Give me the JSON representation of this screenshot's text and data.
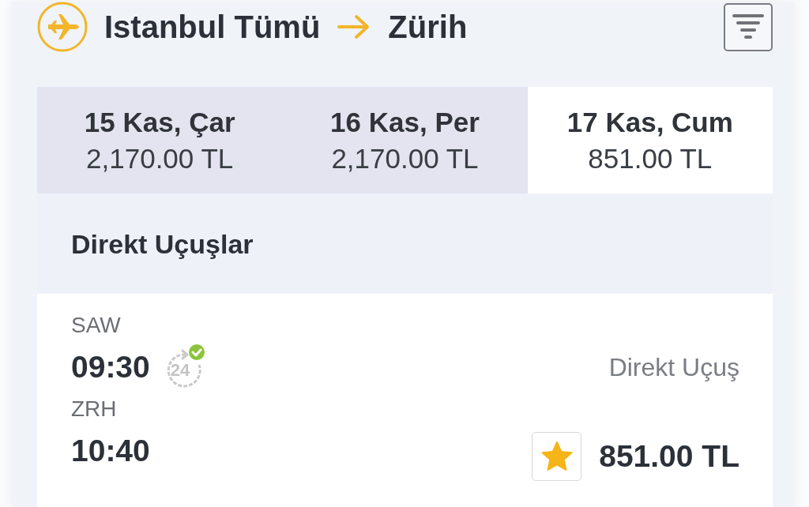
{
  "header": {
    "origin": "Istanbul Tümü",
    "destination": "Zürih"
  },
  "date_tabs": [
    {
      "date": "15 Kas, Çar",
      "price": "2,170.00 TL",
      "selected": false
    },
    {
      "date": "16 Kas, Per",
      "price": "2,170.00 TL",
      "selected": false
    },
    {
      "date": "17 Kas, Cum",
      "price": "851.00 TL",
      "selected": true
    }
  ],
  "section": {
    "title": "Direkt Uçuşlar"
  },
  "flights": [
    {
      "departure_airport": "SAW",
      "departure_time": "09:30",
      "clock_icon_label": "24",
      "arrival_airport": "ZRH",
      "arrival_time": "10:40",
      "flight_type": "Direkt Uçuş",
      "favorite": true,
      "price": "851.00 TL"
    }
  ]
}
